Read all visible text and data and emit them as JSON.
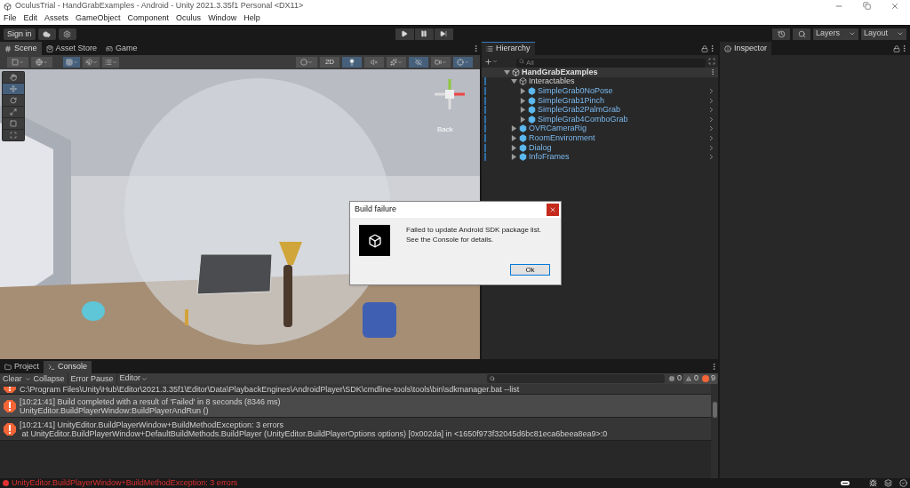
{
  "window": {
    "title": "OculusTrial - HandGrabExamples - Android - Unity 2021.3.35f1 Personal <DX11>"
  },
  "menu": [
    "File",
    "Edit",
    "Assets",
    "GameObject",
    "Component",
    "Oculus",
    "Window",
    "Help"
  ],
  "toolbar": {
    "sign_in": "Sign in",
    "layers": "Layers",
    "layout": "Layout"
  },
  "scene_tabs": [
    {
      "label": "Scene",
      "selected": true
    },
    {
      "label": "Asset Store",
      "selected": false
    },
    {
      "label": "Game",
      "selected": false
    }
  ],
  "scene_toolbar": {
    "two_d": "2D",
    "lighting_on": true,
    "audio_on": false,
    "visibility_on": true,
    "gizmos_on": true,
    "grid_on": true
  },
  "tools": [
    {
      "kind": "hand",
      "selected": false
    },
    {
      "kind": "move",
      "selected": true
    },
    {
      "kind": "rotate",
      "selected": false
    },
    {
      "kind": "scale",
      "selected": false
    },
    {
      "kind": "rect",
      "selected": false
    },
    {
      "kind": "transform",
      "selected": false
    }
  ],
  "gizmo_label": "Back",
  "hierarchy": {
    "title": "Hierarchy",
    "search": {
      "placeholder": "All"
    },
    "root": {
      "label": "HandGrabExamples",
      "expanded": true,
      "children": [
        {
          "label": "Interactables",
          "prefab": false,
          "expanded": true,
          "children": [
            {
              "label": "SimpleGrab0NoPose",
              "prefab": true,
              "expanded": false
            },
            {
              "label": "SimpleGrab1Pinch",
              "prefab": true,
              "expanded": false
            },
            {
              "label": "SimpleGrab2PalmGrab",
              "prefab": true,
              "expanded": false
            },
            {
              "label": "SimpleGrab4ComboGrab",
              "prefab": true,
              "expanded": false
            }
          ]
        },
        {
          "label": "OVRCameraRig",
          "prefab": true,
          "expanded": false
        },
        {
          "label": "RoomEnvironment",
          "prefab": true,
          "expanded": false
        },
        {
          "label": "Dialog",
          "prefab": true,
          "expanded": false
        },
        {
          "label": "InfoFrames",
          "prefab": true,
          "expanded": false
        }
      ]
    }
  },
  "inspector": {
    "title": "Inspector"
  },
  "dialog": {
    "title": "Build failure",
    "message": "Failed to update Android SDK package list. See the Console for details.",
    "button": "Ok"
  },
  "bottom_tabs": [
    {
      "label": "Project",
      "selected": false
    },
    {
      "label": "Console",
      "selected": true
    }
  ],
  "console": {
    "buttons": [
      "Clear",
      "Collapse",
      "Error Pause",
      "Editor"
    ],
    "counts": {
      "info": "0",
      "warning": "0",
      "error": "9"
    },
    "rows": [
      {
        "lines": [
          "C:\\Program Files\\Unity\\Hub\\Editor\\2021.3.35f1\\Editor\\Data\\PlaybackEngines\\AndroidPlayer\\SDK\\cmdline-tools\\tools\\bin\\sdkmanager.bat --list"
        ],
        "cut": true,
        "selected": false
      },
      {
        "lines": [
          "[10:21:41] Build completed with a result of 'Failed' in 8 seconds (8346 ms)",
          "UnityEditor.BuildPlayerWindow:BuildPlayerAndRun ()"
        ],
        "cut": false,
        "selected": true
      },
      {
        "lines": [
          "[10:21:41] UnityEditor.BuildPlayerWindow+BuildMethodException: 3 errors",
          " at UnityEditor.BuildPlayerWindow+DefaultBuildMethods.BuildPlayer (UnityEditor.BuildPlayerOptions options) [0x002da] in <1650f973f32045d6bc81eca6beea8ea9>:0"
        ],
        "cut": false,
        "selected": false
      }
    ]
  },
  "status_bar": {
    "message": "UnityEditor.BuildPlayerWindow+BuildMethodException: 3 errors"
  }
}
